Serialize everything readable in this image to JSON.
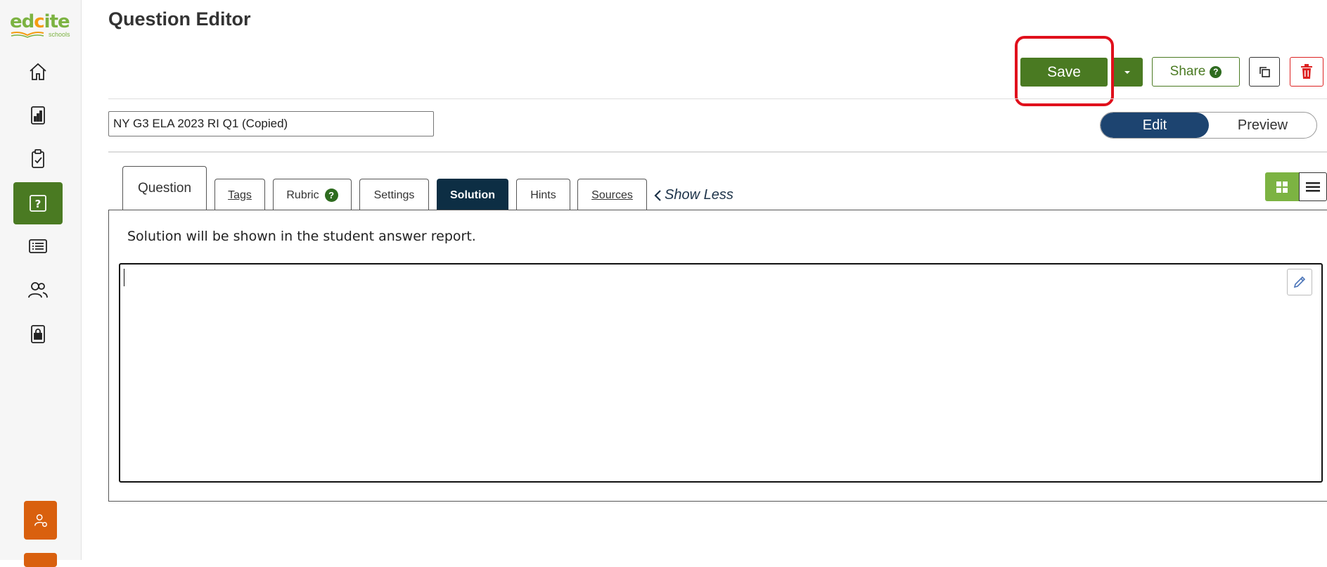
{
  "app": {
    "logo_text_main_a": "ed",
    "logo_text_main_b": "c",
    "logo_text_main_c": "ite",
    "logo_text_sub": "schools"
  },
  "sidebar": {
    "items": [
      {
        "icon": "home-icon"
      },
      {
        "icon": "bar-chart-icon"
      },
      {
        "icon": "clipboard-check-icon"
      },
      {
        "icon": "question-icon",
        "active": true
      },
      {
        "icon": "list-icon"
      },
      {
        "icon": "users-icon"
      },
      {
        "icon": "lock-icon"
      }
    ],
    "bottom_icon": "user-settings-icon"
  },
  "header": {
    "title": "Question Editor",
    "save_label": "Save",
    "share_label": "Share",
    "share_help": "?"
  },
  "question": {
    "title_value": "NY G3 ELA 2023 RI Q1 (Copied)"
  },
  "mode_toggle": {
    "edit_label": "Edit",
    "preview_label": "Preview",
    "selected": "Edit"
  },
  "tabs": {
    "question": "Question",
    "tags": "Tags",
    "rubric": "Rubric",
    "rubric_help": "?",
    "settings": "Settings",
    "solution": "Solution",
    "hints": "Hints",
    "sources": "Sources",
    "active": "Solution"
  },
  "show_less_label": "Show Less",
  "solution_panel": {
    "note": "Solution will be shown in the student answer report.",
    "editor_value": ""
  },
  "colors": {
    "primary_green": "#4a7a22",
    "active_tab": "#0d2e44",
    "toggle_blue": "#1d4470",
    "highlight": "#e0101c",
    "delete_red": "#dd2222",
    "sidebar_bottom": "#d9600e"
  }
}
